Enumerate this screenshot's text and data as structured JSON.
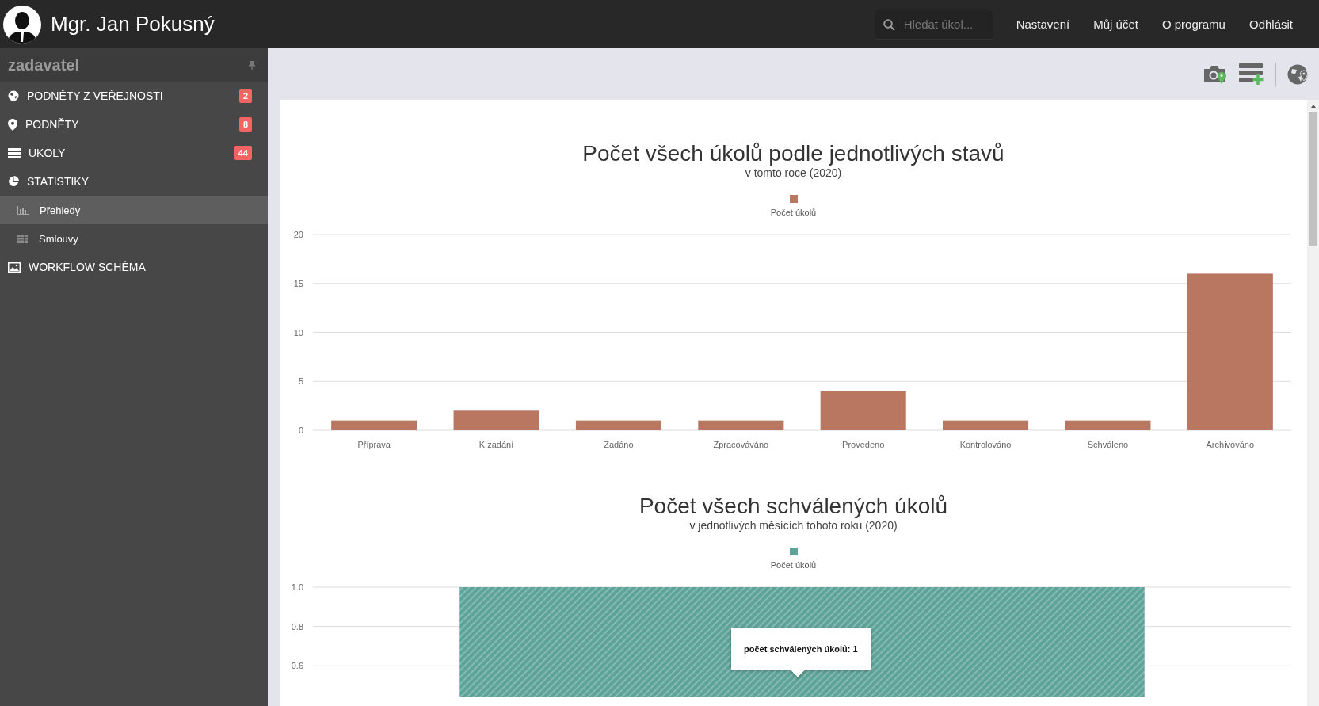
{
  "header": {
    "user_name": "Mgr. Jan Pokusný",
    "search": {
      "placeholder": "Hledat úkol..."
    },
    "nav": [
      "Nastavení",
      "Můj účet",
      "O programu",
      "Odhlásit"
    ]
  },
  "sidebar": {
    "title": "zadavatel",
    "items": [
      {
        "label": "PODNĚTY Z VEŘEJNOSTI",
        "badge": "2",
        "selected": false
      },
      {
        "label": "PODNĚTY",
        "badge": "8",
        "selected": false
      },
      {
        "label": "ÚKOLY",
        "badge": "44",
        "selected": false
      },
      {
        "label": "STATISTIKY",
        "selected": false,
        "children": [
          {
            "label": "Přehledy",
            "selected": true
          },
          {
            "label": "Smlouvy",
            "selected": false
          }
        ]
      },
      {
        "label": "WORKFLOW SCHÉMA",
        "selected": false
      }
    ]
  },
  "charts": [
    {
      "title": "Počet všech úkolů podle jednotlivých stavů",
      "subtitle": "v tomto roce (2020)",
      "chart_data": {
        "type": "bar",
        "categories": [
          "Příprava",
          "K zadání",
          "Zadáno",
          "Zpracováváno",
          "Provedeno",
          "Kontrolováno",
          "Schváleno",
          "Archivováno"
        ],
        "series": [
          {
            "name": "Počet úkolů",
            "color": "#b97762",
            "values": [
              1,
              2,
              1,
              1,
              4,
              1,
              1,
              16
            ]
          }
        ],
        "grid": true,
        "ylim": [
          0,
          20
        ],
        "yticks": [
          0,
          5,
          10,
          15,
          20
        ]
      }
    },
    {
      "title": "Počet všech schválených úkolů",
      "subtitle": "v jednotlivých měsících tohoto roku (2020)",
      "tooltip": "počet schválených úkolů: 1",
      "chart_data": {
        "type": "bar",
        "series": [
          {
            "name": "Počet úkolů",
            "color": "#5ea399",
            "values": [
              1
            ]
          }
        ],
        "grid": true,
        "ylim": [
          0.44,
          1.0
        ],
        "yticks": [
          {
            "value": 0.6,
            "label": "0.6"
          },
          {
            "value": 0.8,
            "label": "0.8"
          },
          {
            "value": 1.0,
            "label": "1.0"
          }
        ]
      }
    }
  ]
}
